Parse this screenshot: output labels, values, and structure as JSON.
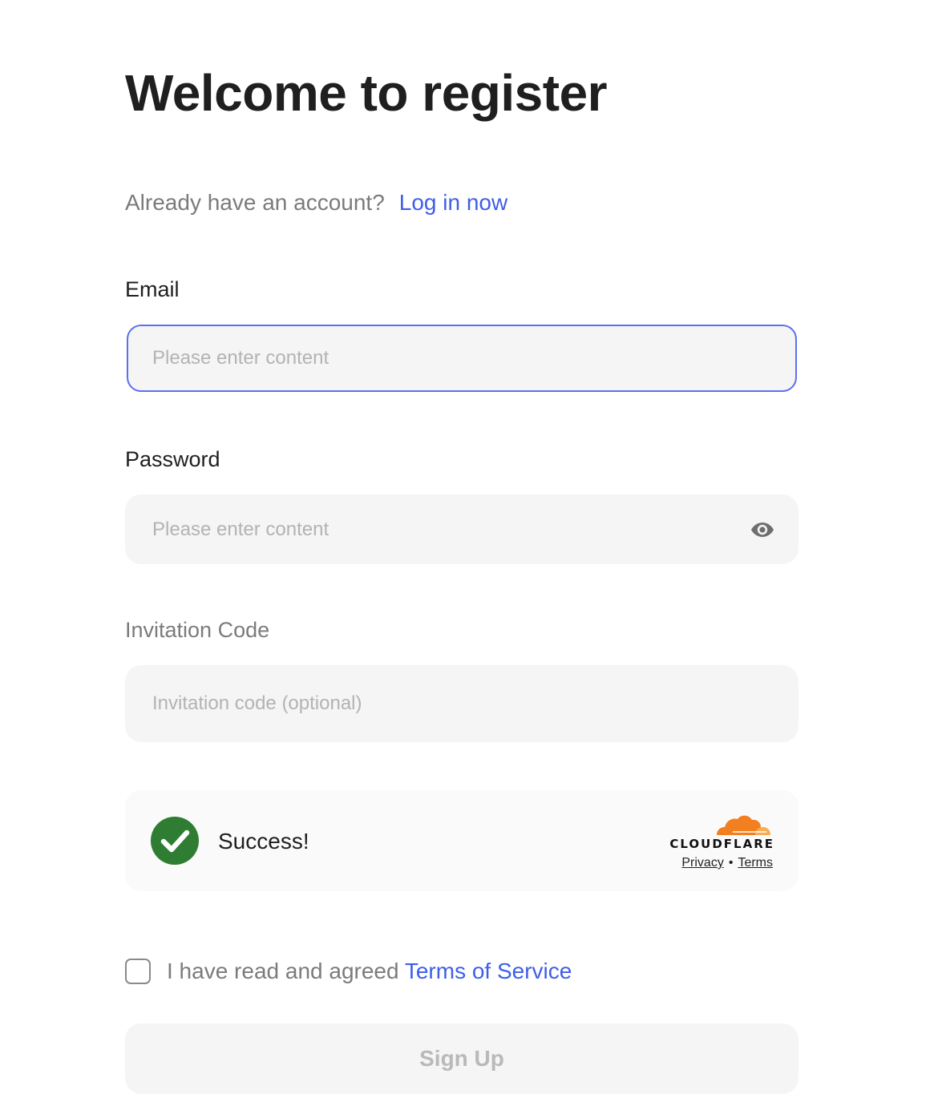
{
  "page": {
    "title": "Welcome to register"
  },
  "login_prompt": {
    "text": "Already have an account?",
    "link_label": "Log in now"
  },
  "email": {
    "label": "Email",
    "placeholder": "Please enter content",
    "value": ""
  },
  "password": {
    "label": "Password",
    "placeholder": "Please enter content",
    "value": "",
    "toggle_icon": "eye-icon"
  },
  "invitation": {
    "label": "Invitation Code",
    "placeholder": "Invitation code (optional)",
    "value": ""
  },
  "captcha": {
    "status": "Success!",
    "status_icon": "check-circle-icon",
    "brand": "CLOUDFLARE",
    "privacy_label": "Privacy",
    "separator": "•",
    "terms_label": "Terms"
  },
  "agreement": {
    "text": "I have read and agreed",
    "link_label": "Terms of Service",
    "checked": false
  },
  "submit": {
    "label": "Sign Up",
    "disabled": true
  },
  "colors": {
    "link": "#3f5ee8",
    "focus_border": "#5b6ff0",
    "field_bg": "#f5f5f5",
    "success_green": "#2e7d32",
    "cloudflare_orange": "#f38020"
  }
}
